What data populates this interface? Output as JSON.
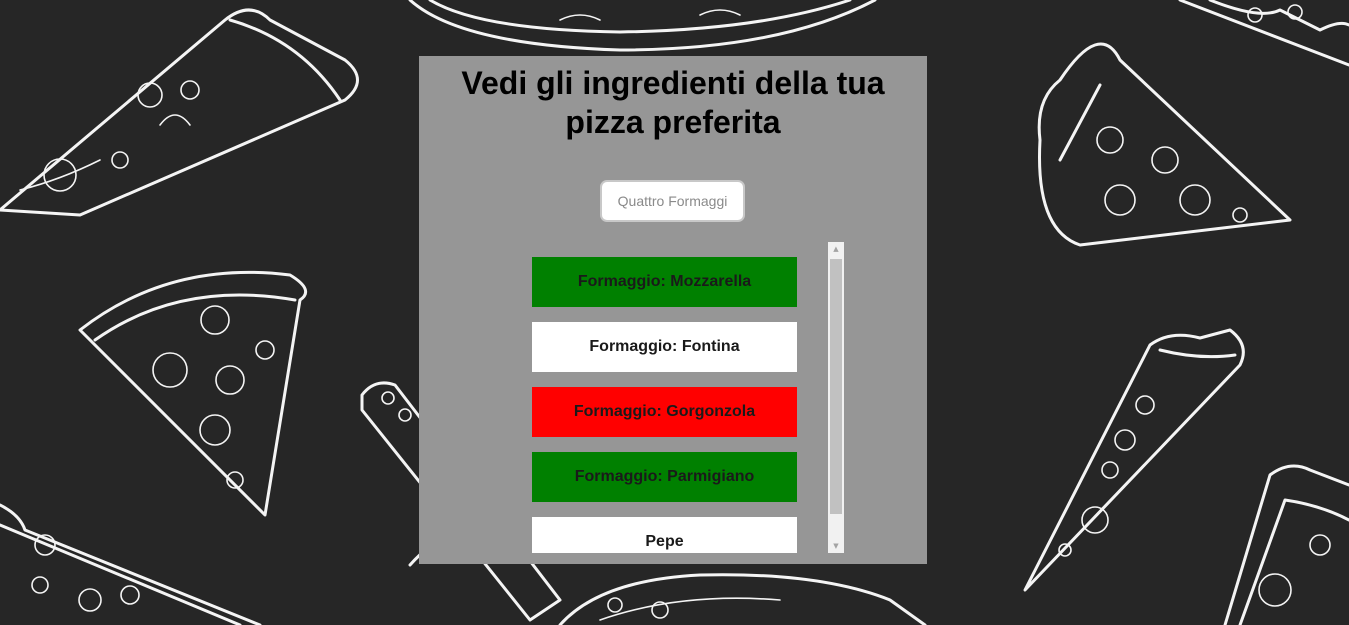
{
  "page": {
    "title": "Vedi gli ingredienti della tua pizza preferita"
  },
  "search": {
    "placeholder": "Quattro Formaggi",
    "value": ""
  },
  "ingredients": [
    {
      "label": "Formaggio: Mozzarella",
      "color": "#008000"
    },
    {
      "label": "Formaggio: Fontina",
      "color": "#ffffff"
    },
    {
      "label": "Formaggio: Gorgonzola",
      "color": "#ff0000"
    },
    {
      "label": "Formaggio: Parmigiano",
      "color": "#008000"
    },
    {
      "label": "Pepe",
      "color": "#ffffff"
    }
  ],
  "icons": {
    "scroll_up": "up-arrow-icon",
    "scroll_down": "down-arrow-icon",
    "background": "pizza-slice-pattern"
  },
  "colors": {
    "background": "#262626",
    "panel": "#969696"
  }
}
